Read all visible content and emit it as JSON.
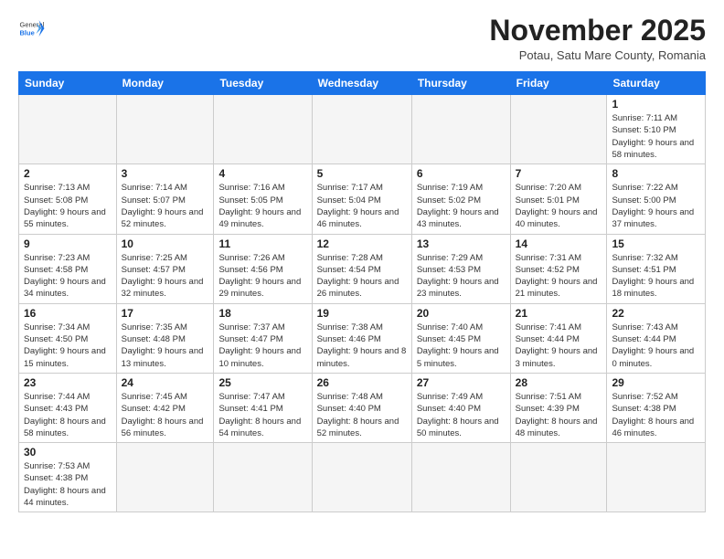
{
  "logo": {
    "general": "General",
    "blue": "Blue"
  },
  "header": {
    "month": "November 2025",
    "location": "Potau, Satu Mare County, Romania"
  },
  "weekdays": [
    "Sunday",
    "Monday",
    "Tuesday",
    "Wednesday",
    "Thursday",
    "Friday",
    "Saturday"
  ],
  "weeks": [
    [
      {
        "day": "",
        "info": ""
      },
      {
        "day": "",
        "info": ""
      },
      {
        "day": "",
        "info": ""
      },
      {
        "day": "",
        "info": ""
      },
      {
        "day": "",
        "info": ""
      },
      {
        "day": "",
        "info": ""
      },
      {
        "day": "1",
        "info": "Sunrise: 7:11 AM\nSunset: 5:10 PM\nDaylight: 9 hours\nand 58 minutes."
      }
    ],
    [
      {
        "day": "2",
        "info": "Sunrise: 7:13 AM\nSunset: 5:08 PM\nDaylight: 9 hours\nand 55 minutes."
      },
      {
        "day": "3",
        "info": "Sunrise: 7:14 AM\nSunset: 5:07 PM\nDaylight: 9 hours\nand 52 minutes."
      },
      {
        "day": "4",
        "info": "Sunrise: 7:16 AM\nSunset: 5:05 PM\nDaylight: 9 hours\nand 49 minutes."
      },
      {
        "day": "5",
        "info": "Sunrise: 7:17 AM\nSunset: 5:04 PM\nDaylight: 9 hours\nand 46 minutes."
      },
      {
        "day": "6",
        "info": "Sunrise: 7:19 AM\nSunset: 5:02 PM\nDaylight: 9 hours\nand 43 minutes."
      },
      {
        "day": "7",
        "info": "Sunrise: 7:20 AM\nSunset: 5:01 PM\nDaylight: 9 hours\nand 40 minutes."
      },
      {
        "day": "8",
        "info": "Sunrise: 7:22 AM\nSunset: 5:00 PM\nDaylight: 9 hours\nand 37 minutes."
      }
    ],
    [
      {
        "day": "9",
        "info": "Sunrise: 7:23 AM\nSunset: 4:58 PM\nDaylight: 9 hours\nand 34 minutes."
      },
      {
        "day": "10",
        "info": "Sunrise: 7:25 AM\nSunset: 4:57 PM\nDaylight: 9 hours\nand 32 minutes."
      },
      {
        "day": "11",
        "info": "Sunrise: 7:26 AM\nSunset: 4:56 PM\nDaylight: 9 hours\nand 29 minutes."
      },
      {
        "day": "12",
        "info": "Sunrise: 7:28 AM\nSunset: 4:54 PM\nDaylight: 9 hours\nand 26 minutes."
      },
      {
        "day": "13",
        "info": "Sunrise: 7:29 AM\nSunset: 4:53 PM\nDaylight: 9 hours\nand 23 minutes."
      },
      {
        "day": "14",
        "info": "Sunrise: 7:31 AM\nSunset: 4:52 PM\nDaylight: 9 hours\nand 21 minutes."
      },
      {
        "day": "15",
        "info": "Sunrise: 7:32 AM\nSunset: 4:51 PM\nDaylight: 9 hours\nand 18 minutes."
      }
    ],
    [
      {
        "day": "16",
        "info": "Sunrise: 7:34 AM\nSunset: 4:50 PM\nDaylight: 9 hours\nand 15 minutes."
      },
      {
        "day": "17",
        "info": "Sunrise: 7:35 AM\nSunset: 4:48 PM\nDaylight: 9 hours\nand 13 minutes."
      },
      {
        "day": "18",
        "info": "Sunrise: 7:37 AM\nSunset: 4:47 PM\nDaylight: 9 hours\nand 10 minutes."
      },
      {
        "day": "19",
        "info": "Sunrise: 7:38 AM\nSunset: 4:46 PM\nDaylight: 9 hours\nand 8 minutes."
      },
      {
        "day": "20",
        "info": "Sunrise: 7:40 AM\nSunset: 4:45 PM\nDaylight: 9 hours\nand 5 minutes."
      },
      {
        "day": "21",
        "info": "Sunrise: 7:41 AM\nSunset: 4:44 PM\nDaylight: 9 hours\nand 3 minutes."
      },
      {
        "day": "22",
        "info": "Sunrise: 7:43 AM\nSunset: 4:44 PM\nDaylight: 9 hours\nand 0 minutes."
      }
    ],
    [
      {
        "day": "23",
        "info": "Sunrise: 7:44 AM\nSunset: 4:43 PM\nDaylight: 8 hours\nand 58 minutes."
      },
      {
        "day": "24",
        "info": "Sunrise: 7:45 AM\nSunset: 4:42 PM\nDaylight: 8 hours\nand 56 minutes."
      },
      {
        "day": "25",
        "info": "Sunrise: 7:47 AM\nSunset: 4:41 PM\nDaylight: 8 hours\nand 54 minutes."
      },
      {
        "day": "26",
        "info": "Sunrise: 7:48 AM\nSunset: 4:40 PM\nDaylight: 8 hours\nand 52 minutes."
      },
      {
        "day": "27",
        "info": "Sunrise: 7:49 AM\nSunset: 4:40 PM\nDaylight: 8 hours\nand 50 minutes."
      },
      {
        "day": "28",
        "info": "Sunrise: 7:51 AM\nSunset: 4:39 PM\nDaylight: 8 hours\nand 48 minutes."
      },
      {
        "day": "29",
        "info": "Sunrise: 7:52 AM\nSunset: 4:38 PM\nDaylight: 8 hours\nand 46 minutes."
      }
    ],
    [
      {
        "day": "30",
        "info": "Sunrise: 7:53 AM\nSunset: 4:38 PM\nDaylight: 8 hours\nand 44 minutes."
      },
      {
        "day": "",
        "info": ""
      },
      {
        "day": "",
        "info": ""
      },
      {
        "day": "",
        "info": ""
      },
      {
        "day": "",
        "info": ""
      },
      {
        "day": "",
        "info": ""
      },
      {
        "day": "",
        "info": ""
      }
    ]
  ]
}
